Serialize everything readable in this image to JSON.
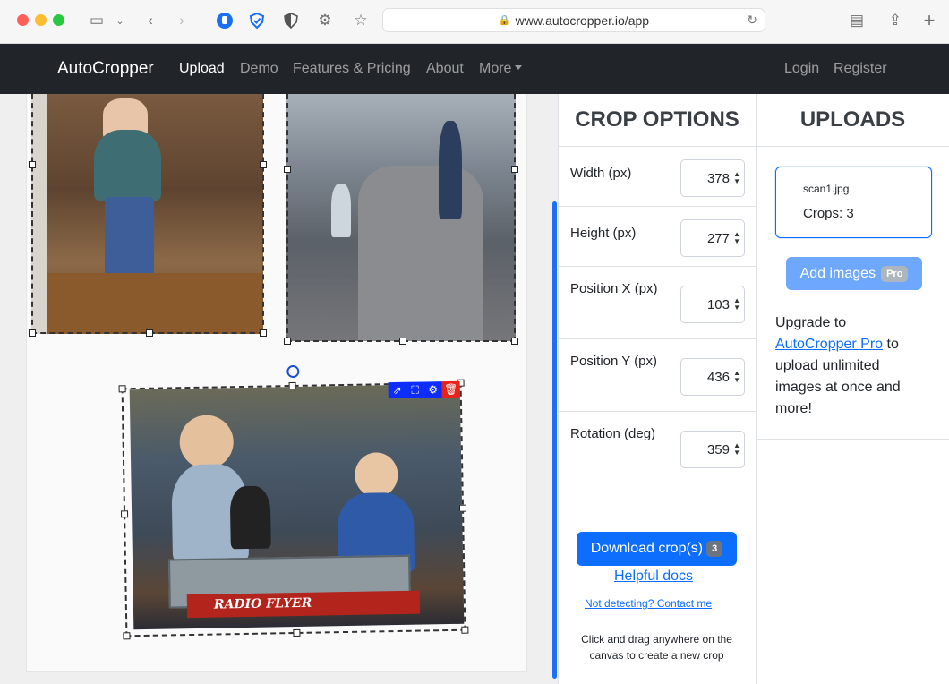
{
  "browser": {
    "url": "www.autocropper.io/app"
  },
  "navbar": {
    "brand": "AutoCropper",
    "links": [
      "Upload",
      "Demo",
      "Features & Pricing",
      "About",
      "More"
    ],
    "login": "Login",
    "register": "Register"
  },
  "photo": {
    "wagon_text": "RADIO FLYER"
  },
  "crop_options": {
    "title": "CROP OPTIONS",
    "fields": [
      {
        "label": "Width (px)",
        "value": "378"
      },
      {
        "label": "Height (px)",
        "value": "277"
      },
      {
        "label": "Position X (px)",
        "value": "103"
      },
      {
        "label": "Position Y (px)",
        "value": "436"
      },
      {
        "label": "Rotation (deg)",
        "value": "359"
      }
    ],
    "download_label": "Download crop(s)",
    "download_count": "3",
    "helpful_docs": "Helpful docs",
    "not_detecting": "Not detecting? Contact me",
    "hint": "Click and drag anywhere on the canvas to create a new crop"
  },
  "uploads": {
    "title": "UPLOADS",
    "file_name": "scan1.jpg",
    "crops_text": "Crops: 3",
    "add_images": "Add images",
    "pro_badge": "Pro",
    "upgrade_prefix": "Upgrade to",
    "upgrade_link": "AutoCropper Pro",
    "upgrade_suffix": "to upload unlimited images at once and more!"
  },
  "colors": {
    "primary": "#0d6efd",
    "navbar_bg": "#212529"
  }
}
